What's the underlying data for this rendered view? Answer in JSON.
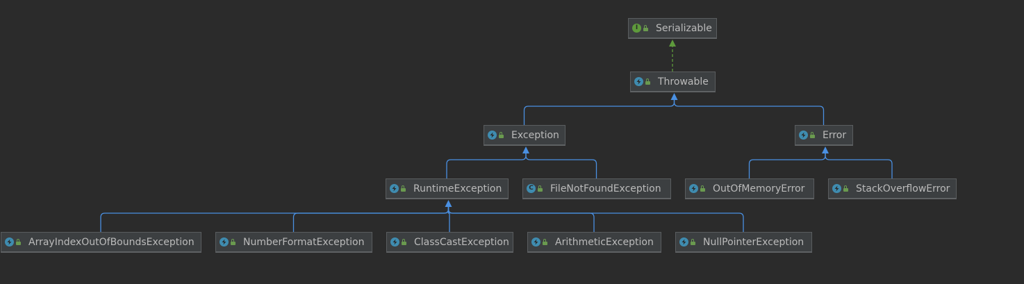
{
  "colors": {
    "background": "#2b2b2b",
    "node_fill": "#3c3f41",
    "inheritance_edge": "#4a90e2",
    "implements_edge": "#5e9a3c"
  },
  "diagram": {
    "nodes": [
      {
        "id": "serializable",
        "label": "Serializable",
        "kind": "interface",
        "kind_letter": "I"
      },
      {
        "id": "throwable",
        "label": "Throwable",
        "kind": "class-abstract-icon"
      },
      {
        "id": "exception",
        "label": "Exception",
        "kind": "class-abstract-icon"
      },
      {
        "id": "error",
        "label": "Error",
        "kind": "class-abstract-icon"
      },
      {
        "id": "runtime-exception",
        "label": "RuntimeException",
        "kind": "class-abstract-icon"
      },
      {
        "id": "file-not-found-exception",
        "label": "FileNotFoundException",
        "kind": "class",
        "kind_letter": "C"
      },
      {
        "id": "out-of-memory-error",
        "label": "OutOfMemoryError",
        "kind": "class-abstract-icon"
      },
      {
        "id": "stack-overflow-error",
        "label": "StackOverflowError",
        "kind": "class-abstract-icon"
      },
      {
        "id": "array-index-out-of-bounds-exception",
        "label": "ArrayIndexOutOfBoundsException",
        "kind": "class-abstract-icon"
      },
      {
        "id": "number-format-exception",
        "label": "NumberFormatException",
        "kind": "class-abstract-icon"
      },
      {
        "id": "class-cast-exception",
        "label": "ClassCastException",
        "kind": "class-abstract-icon"
      },
      {
        "id": "arithmetic-exception",
        "label": "ArithmeticException",
        "kind": "class-abstract-icon"
      },
      {
        "id": "null-pointer-exception",
        "label": "NullPointerException",
        "kind": "class-abstract-icon"
      }
    ],
    "edges": [
      {
        "from": "throwable",
        "to": "serializable",
        "type": "implements"
      },
      {
        "from": "exception",
        "to": "throwable",
        "type": "extends"
      },
      {
        "from": "error",
        "to": "throwable",
        "type": "extends"
      },
      {
        "from": "runtime-exception",
        "to": "exception",
        "type": "extends"
      },
      {
        "from": "file-not-found-exception",
        "to": "exception",
        "type": "extends"
      },
      {
        "from": "out-of-memory-error",
        "to": "error",
        "type": "extends"
      },
      {
        "from": "stack-overflow-error",
        "to": "error",
        "type": "extends"
      },
      {
        "from": "array-index-out-of-bounds-exception",
        "to": "runtime-exception",
        "type": "extends"
      },
      {
        "from": "number-format-exception",
        "to": "runtime-exception",
        "type": "extends"
      },
      {
        "from": "class-cast-exception",
        "to": "runtime-exception",
        "type": "extends"
      },
      {
        "from": "arithmetic-exception",
        "to": "runtime-exception",
        "type": "extends"
      },
      {
        "from": "null-pointer-exception",
        "to": "runtime-exception",
        "type": "extends"
      }
    ]
  }
}
